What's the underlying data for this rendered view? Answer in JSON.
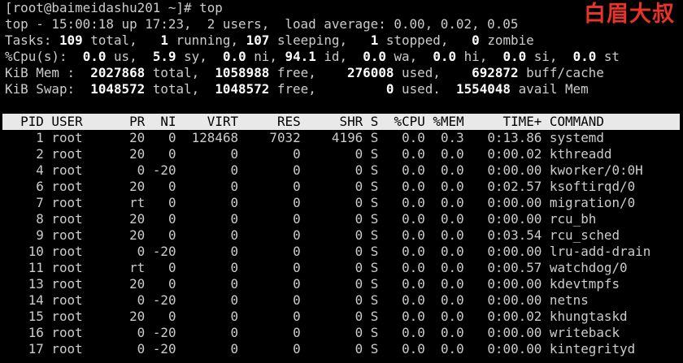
{
  "terminal": {
    "prompt": "[root@baimeidashu201 ~]# top"
  },
  "summary": {
    "uptime_line": "top - 15:00:18 up 17:23,  2 users,  load average: 0.00, 0.02, 0.05",
    "tasks": {
      "label": "Tasks:",
      "total": "109",
      "total_label": "total,",
      "running": "1",
      "running_label": "running,",
      "sleeping": "107",
      "sleeping_label": "sleeping,",
      "stopped": "1",
      "stopped_label": "stopped,",
      "zombie": "0",
      "zombie_label": "zombie"
    },
    "cpu": {
      "label": "%Cpu(s):",
      "us": "0.0",
      "us_label": "us,",
      "sy": "5.9",
      "sy_label": "sy,",
      "ni": "0.0",
      "ni_label": "ni,",
      "id": "94.1",
      "id_label": "id,",
      "wa": "0.0",
      "wa_label": "wa,",
      "hi": "0.0",
      "hi_label": "hi,",
      "si": "0.0",
      "si_label": "si,",
      "st": "0.0",
      "st_label": "st"
    },
    "mem": {
      "label": "KiB Mem :",
      "total": "2027868",
      "total_label": "total,",
      "free": "1058988",
      "free_label": "free,",
      "used": "276008",
      "used_label": "used,",
      "buff_cache": "692872",
      "buff_cache_label": "buff/cache"
    },
    "swap": {
      "label": "KiB Swap:",
      "total": "1048572",
      "total_label": "total,",
      "free": "1048572",
      "free_label": "free,",
      "used": "0",
      "used_label": "used.",
      "avail": "1554048",
      "avail_label": "avail Mem"
    }
  },
  "process_table": {
    "columns": [
      "PID",
      "USER",
      "PR",
      "NI",
      "VIRT",
      "RES",
      "SHR",
      "S",
      "%CPU",
      "%MEM",
      "TIME+",
      "COMMAND"
    ],
    "rows": [
      [
        "1",
        "root",
        "20",
        "0",
        "128468",
        "7032",
        "4196",
        "S",
        "0.0",
        "0.3",
        "0:13.86",
        "systemd"
      ],
      [
        "2",
        "root",
        "20",
        "0",
        "0",
        "0",
        "0",
        "S",
        "0.0",
        "0.0",
        "0:00.02",
        "kthreadd"
      ],
      [
        "4",
        "root",
        "0",
        "-20",
        "0",
        "0",
        "0",
        "S",
        "0.0",
        "0.0",
        "0:00.00",
        "kworker/0:0H"
      ],
      [
        "6",
        "root",
        "20",
        "0",
        "0",
        "0",
        "0",
        "S",
        "0.0",
        "0.0",
        "0:02.57",
        "ksoftirqd/0"
      ],
      [
        "7",
        "root",
        "rt",
        "0",
        "0",
        "0",
        "0",
        "S",
        "0.0",
        "0.0",
        "0:00.00",
        "migration/0"
      ],
      [
        "8",
        "root",
        "20",
        "0",
        "0",
        "0",
        "0",
        "S",
        "0.0",
        "0.0",
        "0:00.00",
        "rcu_bh"
      ],
      [
        "9",
        "root",
        "20",
        "0",
        "0",
        "0",
        "0",
        "S",
        "0.0",
        "0.0",
        "0:03.54",
        "rcu_sched"
      ],
      [
        "10",
        "root",
        "0",
        "-20",
        "0",
        "0",
        "0",
        "S",
        "0.0",
        "0.0",
        "0:00.00",
        "lru-add-drain"
      ],
      [
        "11",
        "root",
        "rt",
        "0",
        "0",
        "0",
        "0",
        "S",
        "0.0",
        "0.0",
        "0:00.57",
        "watchdog/0"
      ],
      [
        "13",
        "root",
        "20",
        "0",
        "0",
        "0",
        "0",
        "S",
        "0.0",
        "0.0",
        "0:00.00",
        "kdevtmpfs"
      ],
      [
        "14",
        "root",
        "0",
        "-20",
        "0",
        "0",
        "0",
        "S",
        "0.0",
        "0.0",
        "0:00.00",
        "netns"
      ],
      [
        "15",
        "root",
        "20",
        "0",
        "0",
        "0",
        "0",
        "S",
        "0.0",
        "0.0",
        "0:00.02",
        "khungtaskd"
      ],
      [
        "16",
        "root",
        "0",
        "-20",
        "0",
        "0",
        "0",
        "S",
        "0.0",
        "0.0",
        "0:00.00",
        "writeback"
      ],
      [
        "17",
        "root",
        "0",
        "-20",
        "0",
        "0",
        "0",
        "S",
        "0.0",
        "0.0",
        "0:00.00",
        "kintegrityd"
      ]
    ]
  },
  "watermark": {
    "text": "白眉大叔",
    "color": "#e8332a"
  },
  "colors": {
    "background": "#000000",
    "text": "#cccccc",
    "bold_text": "#ffffff",
    "header_bg": "#e9e9e9",
    "header_text": "#000000"
  }
}
